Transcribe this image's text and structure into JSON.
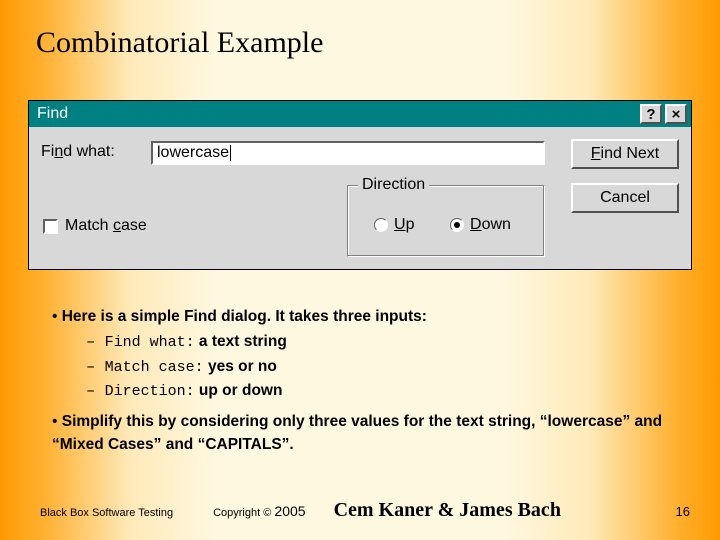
{
  "title": "Combinatorial Example",
  "dialog": {
    "caption": "Find",
    "help_btn": "?",
    "close_btn": "×",
    "find_what_label_prefix": "Fi",
    "find_what_label_u": "n",
    "find_what_label_suffix": "d what:",
    "find_what_value": "lowercase",
    "match_case_prefix": "Match ",
    "match_case_u": "c",
    "match_case_suffix": "ase",
    "direction_legend": "Direction",
    "up_u": "U",
    "up_suffix": "p",
    "down_u": "D",
    "down_suffix": "own",
    "find_next_u": "F",
    "find_next_suffix": "ind Next",
    "cancel_label": "Cancel"
  },
  "body": {
    "line1": "Here is a simple Find dialog. It takes three inputs:",
    "item1_mono": "Find what:",
    "item1_rest": " a text string",
    "item2_mono": "Match case:",
    "item2_rest": "  yes or no",
    "item3_mono": "Direction:",
    "item3_rest": " up or down",
    "line2": "Simplify this by considering only three values for the text string, “lowercase” and “Mixed Cases” and “CAPITALS”."
  },
  "footer": {
    "left": "Black Box Software Testing",
    "copy": "Copyright ©",
    "year": "2005",
    "names": "Cem Kaner & James Bach",
    "page": "16"
  }
}
